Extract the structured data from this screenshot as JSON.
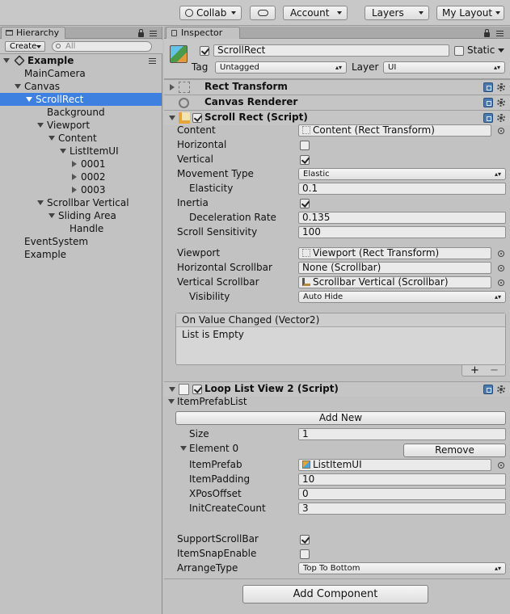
{
  "toolbar": {
    "collab": "Collab",
    "account": "Account",
    "layers": "Layers",
    "layout": "My Layout"
  },
  "hierarchy": {
    "tab": "Hierarchy",
    "create": "Create",
    "search_placeholder": "All",
    "scene": "Example",
    "items": [
      {
        "label": "MainCamera"
      },
      {
        "label": "Canvas"
      },
      {
        "label": "ScrollRect"
      },
      {
        "label": "Background"
      },
      {
        "label": "Viewport"
      },
      {
        "label": "Content"
      },
      {
        "label": "ListItemUI"
      },
      {
        "label": "0001"
      },
      {
        "label": "0002"
      },
      {
        "label": "0003"
      },
      {
        "label": "Scrollbar Vertical"
      },
      {
        "label": "Sliding Area"
      },
      {
        "label": "Handle"
      },
      {
        "label": "EventSystem"
      },
      {
        "label": "Example"
      }
    ]
  },
  "inspector": {
    "tab": "Inspector",
    "object_name": "ScrollRect",
    "static_label": "Static",
    "tag_label": "Tag",
    "tag_value": "Untagged",
    "layer_label": "Layer",
    "layer_value": "UI",
    "rect_transform": "Rect Transform",
    "canvas_renderer": "Canvas Renderer",
    "scroll_rect": {
      "title": "Scroll Rect (Script)",
      "content_label": "Content",
      "content_value": "Content (Rect Transform)",
      "horizontal_label": "Horizontal",
      "vertical_label": "Vertical",
      "movement_label": "Movement Type",
      "movement_value": "Elastic",
      "elasticity_label": "Elasticity",
      "elasticity_value": "0.1",
      "inertia_label": "Inertia",
      "decel_label": "Deceleration Rate",
      "decel_value": "0.135",
      "sensitivity_label": "Scroll Sensitivity",
      "sensitivity_value": "100",
      "viewport_label": "Viewport",
      "viewport_value": "Viewport (Rect Transform)",
      "hscroll_label": "Horizontal Scrollbar",
      "hscroll_value": "None (Scrollbar)",
      "vscroll_label": "Vertical Scrollbar",
      "vscroll_value": "Scrollbar Vertical (Scrollbar)",
      "visibility_label": "Visibility",
      "visibility_value": "Auto Hide",
      "event_title": "On Value Changed (Vector2)",
      "event_empty": "List is Empty",
      "plus": "+",
      "minus": "−"
    },
    "loop_list": {
      "title": "Loop List View 2 (Script)",
      "prefab_list_label": "ItemPrefabList",
      "add_new": "Add New",
      "size_label": "Size",
      "size_value": "1",
      "element_label": "Element 0",
      "remove": "Remove",
      "item_prefab_label": "ItemPrefab",
      "item_prefab_value": "ListItemUI",
      "item_padding_label": "ItemPadding",
      "item_padding_value": "10",
      "xpos_label": "XPosOffset",
      "xpos_value": "0",
      "init_count_label": "InitCreateCount",
      "init_count_value": "3",
      "support_scroll_label": "SupportScrollBar",
      "snap_label": "ItemSnapEnable",
      "arrange_label": "ArrangeType",
      "arrange_value": "Top To Bottom"
    },
    "add_component": "Add Component"
  },
  "colors": {
    "selection": "#3d80df",
    "panel": "#c2c2c2"
  }
}
